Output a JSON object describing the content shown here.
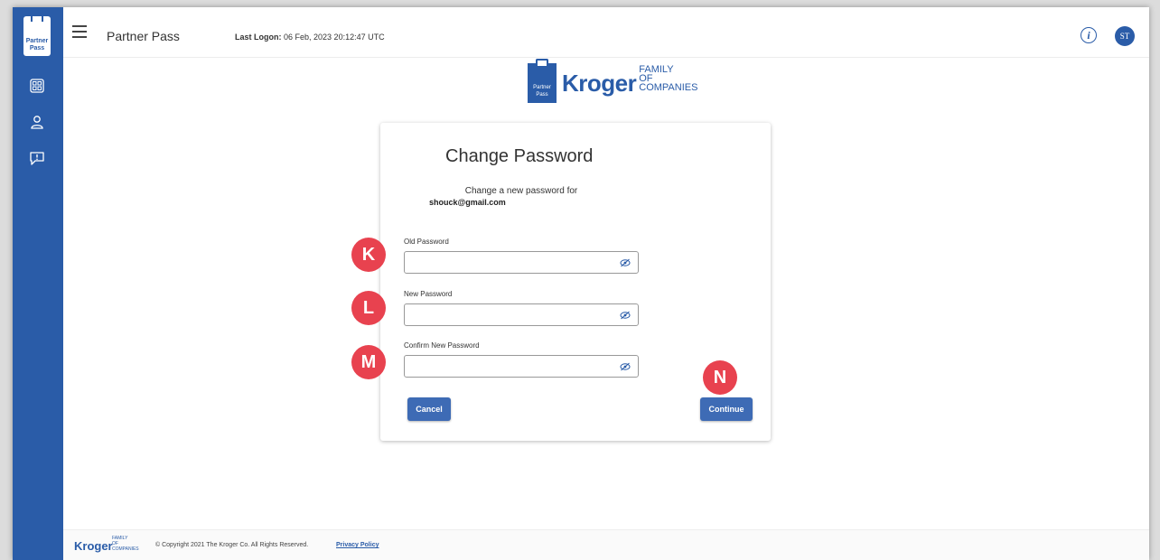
{
  "sidebar": {
    "logo_line1": "Partner",
    "logo_line2": "Pass",
    "icons": [
      "dashboard-icon",
      "user-icon",
      "feedback-icon"
    ]
  },
  "header": {
    "app_title": "Partner Pass",
    "last_logon_label": "Last Logon:",
    "last_logon_value": "06 Feb, 2023 20:12:47 UTC",
    "info_icon": "i",
    "avatar_initials": "ST"
  },
  "brand": {
    "box_line1": "Partner",
    "box_line2": "Pass",
    "name": "Kroger",
    "family_line1": "FAMILY",
    "family_line2": "OF",
    "family_line3": "COMPANIES"
  },
  "form": {
    "title": "Change Password",
    "subtitle": "Change a new password for",
    "email": "shouck@gmail.com",
    "fields": [
      {
        "label": "Old Password",
        "value": ""
      },
      {
        "label": "New Password",
        "value": ""
      },
      {
        "label": "Confirm New Password",
        "value": ""
      }
    ],
    "cancel_label": "Cancel",
    "continue_label": "Continue"
  },
  "callouts": [
    "K",
    "L",
    "M",
    "N"
  ],
  "footer": {
    "brand": "Kroger",
    "family_line1": "FAMILY",
    "family_line2": "OF",
    "family_line3": "COMPANIES",
    "copyright": "© Copyright 2021 The Kroger Co. All Rights Reserved.",
    "privacy_link": "Privacy Policy"
  },
  "colors": {
    "primary": "#2a5ca8",
    "button": "#3e6bb5",
    "callout": "#e8424f"
  }
}
